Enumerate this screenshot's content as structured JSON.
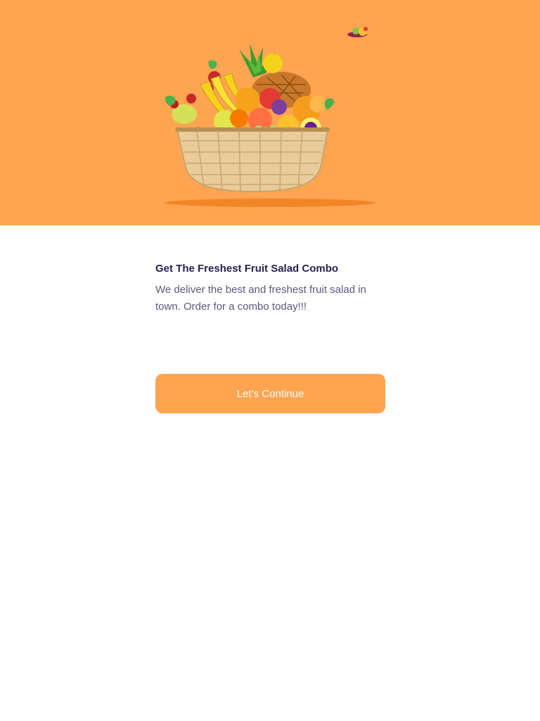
{
  "hero": {
    "background_color": "#FFA451",
    "illustration": "fruit-basket",
    "decoration": "small-fruits-icon"
  },
  "onboarding": {
    "headline": "Get The Freshest Fruit Salad Combo",
    "description": "We deliver the best and freshest fruit salad in town. Order for a combo today!!!"
  },
  "cta": {
    "label": "Let’s Continue",
    "color": "#FFA451"
  }
}
